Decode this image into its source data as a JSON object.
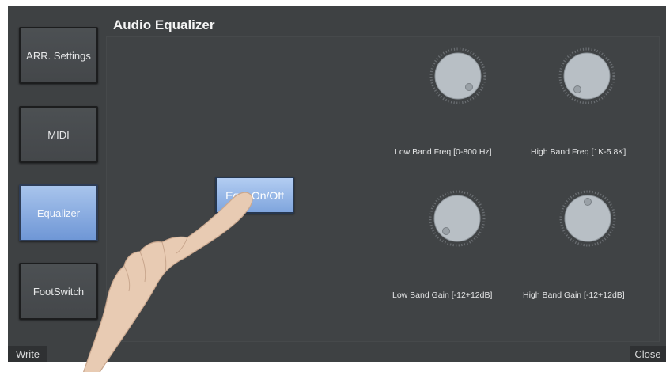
{
  "title": "Audio Equalizer",
  "sidebar": {
    "items": [
      {
        "label": "ARR. Settings",
        "active": false
      },
      {
        "label": "MIDI",
        "active": false
      },
      {
        "label": "Equalizer",
        "active": true
      },
      {
        "label": "FootSwitch",
        "active": false
      }
    ]
  },
  "equalizer": {
    "toggle_label": "Equ. On/Off",
    "knobs": [
      {
        "label": "Low Band Freq [0-800 Hz]"
      },
      {
        "label": "High Band Freq [1K-5.8K]"
      },
      {
        "label": "Low Band Gain [-12+12dB]"
      },
      {
        "label": "High Band Gain [-12+12dB]"
      }
    ]
  },
  "footer": {
    "write_label": "Write",
    "close_label": "Close"
  },
  "colors": {
    "background": "#3e4143",
    "accent": "#7fa5dd",
    "knob": "#b9c0c6"
  }
}
